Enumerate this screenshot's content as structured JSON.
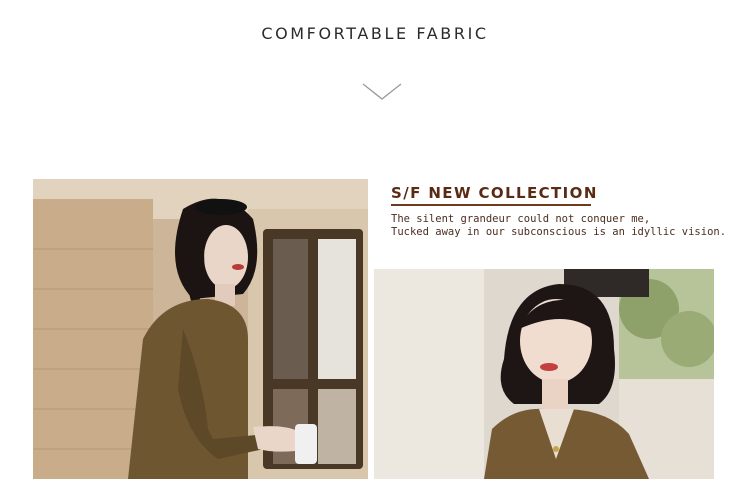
{
  "header": {
    "title": "COMFORTABLE FABRIC",
    "subtext_line1": "",
    "subtext_line2": ""
  },
  "collection": {
    "title": "S/F NEW COLLECTION",
    "line1": "The silent grandeur could not conquer me,",
    "line2": "Tucked away in our subconscious is an idyllic vision."
  },
  "colors": {
    "accent": "#5a2b14",
    "jacket": "#6e5630"
  },
  "icons": {
    "divider": "chevron-down-icon"
  }
}
